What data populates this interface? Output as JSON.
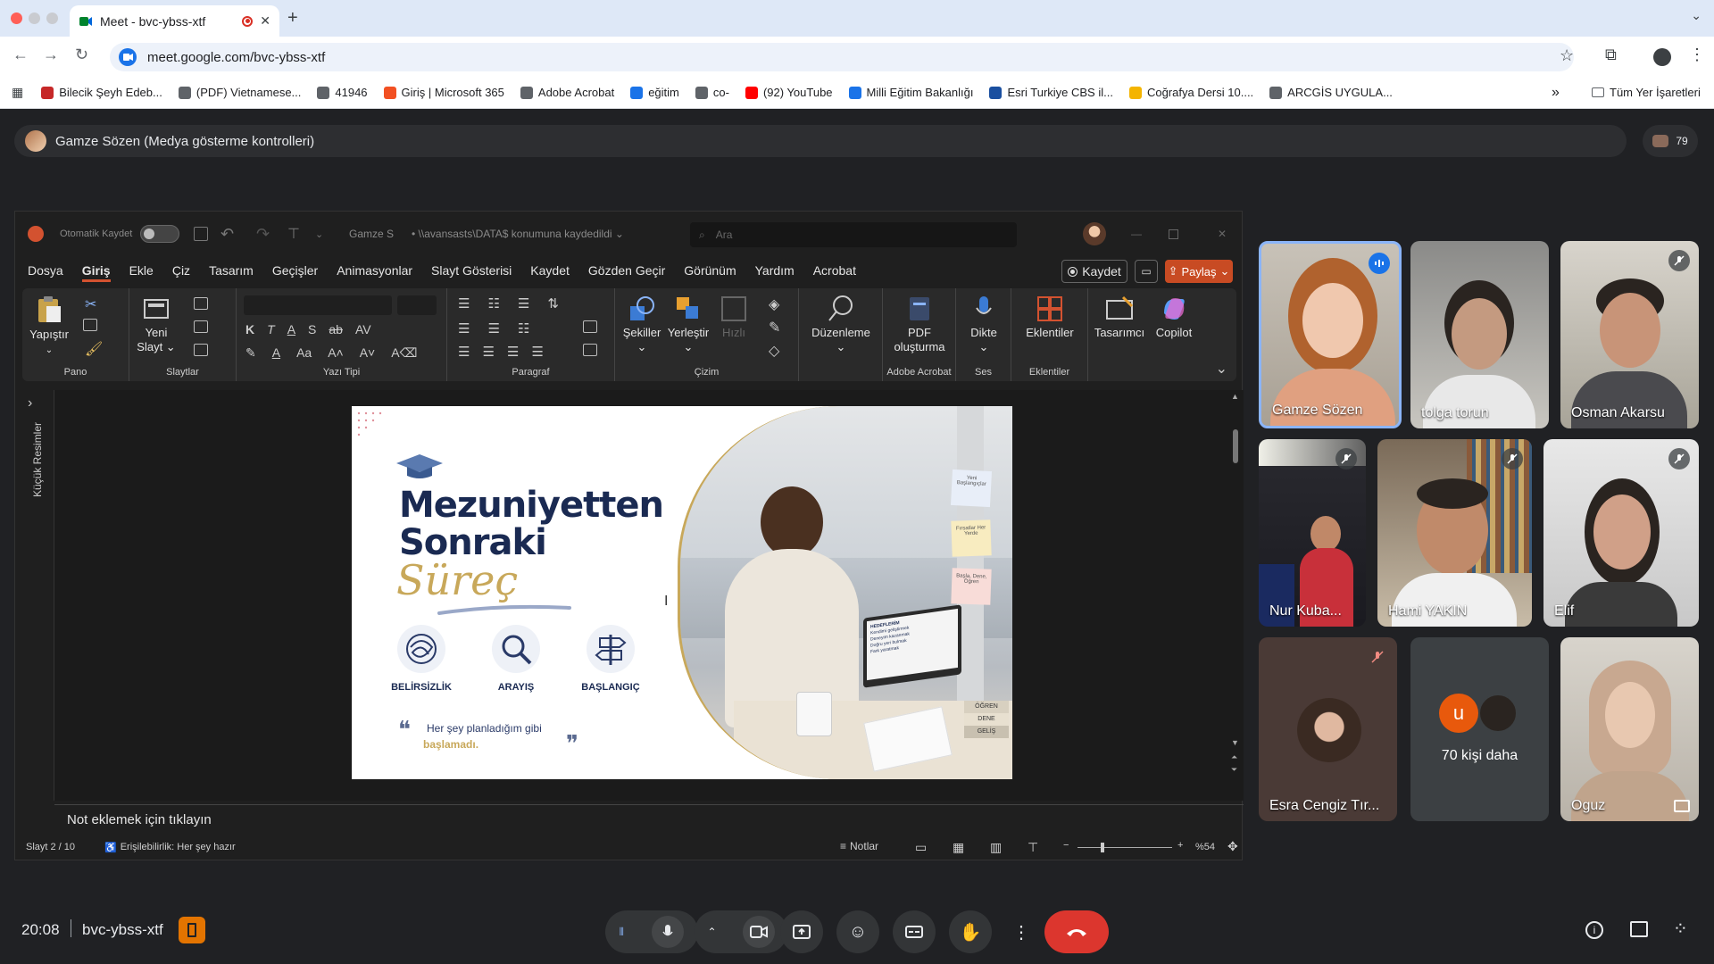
{
  "browser": {
    "tab_title": "Meet - bvc-ybss-xtf",
    "url": "meet.google.com/bvc-ybss-xtf",
    "bookmarks": [
      {
        "label": "Bilecik Şeyh Edeb...",
        "color": "#c62828"
      },
      {
        "label": "(PDF) Vietnamese...",
        "color": "#5f6368"
      },
      {
        "label": "41946",
        "color": "#5f6368"
      },
      {
        "label": "Giriş | Microsoft 365",
        "color": "#f25022"
      },
      {
        "label": "Adobe Acrobat",
        "color": "#5f6368"
      },
      {
        "label": "eğitim",
        "color": "#1a73e8"
      },
      {
        "label": "co-",
        "color": "#5f6368"
      },
      {
        "label": "(92) YouTube",
        "color": "#ff0000"
      },
      {
        "label": "Milli Eğitim Bakanlığı",
        "color": "#1a73e8"
      },
      {
        "label": "Esri Turkiye CBS il...",
        "color": "#1a4fa0"
      },
      {
        "label": "Coğrafya Dersi 10....",
        "color": "#f4b400"
      },
      {
        "label": "ARCGİS UYGULA...",
        "color": "#5f6368"
      }
    ],
    "bookmark_overflow": "»",
    "all_bookmarks": "Tüm Yer İşaretleri"
  },
  "meet": {
    "presenter_bar": "Gamze Sözen (Medya gösterme kontrolleri)",
    "participant_count": "79",
    "time": "20:08",
    "meeting_code": "bvc-ybss-xtf",
    "participants": [
      {
        "name": "Gamze Sözen",
        "speaking": true
      },
      {
        "name": "tolga torun"
      },
      {
        "name": "Osman Akarsu",
        "muted": true
      },
      {
        "name": "Nur Kuba...",
        "muted": true
      },
      {
        "name": "Hami YAKIN",
        "muted": true
      },
      {
        "name": "Elif",
        "muted": true
      },
      {
        "name": "Esra Cengiz Tır...",
        "muted": true
      },
      {
        "name": "70 kişi daha",
        "avatar_letter": "u"
      },
      {
        "name": "Oguz"
      }
    ]
  },
  "ppt": {
    "autosave": "Otomatik Kaydet",
    "doc_owner": "Gamze S",
    "save_location": "\\\\avansasts\\DATA$ konumuna kaydedildi",
    "search_placeholder": "Ara",
    "menu": [
      "Dosya",
      "Giriş",
      "Ekle",
      "Çiz",
      "Tasarım",
      "Geçişler",
      "Animasyonlar",
      "Slayt Gösterisi",
      "Kaydet",
      "Gözden Geçir",
      "Görünüm",
      "Yardım",
      "Acrobat"
    ],
    "record_btn": "Kaydet",
    "share_btn": "Paylaş",
    "ribbon": {
      "paste": "Yapıştır",
      "new_slide_1": "Yeni",
      "new_slide_2": "Slayt",
      "shapes": "Şekiller",
      "arrange": "Yerleştir",
      "quick": "Hızlı",
      "editing": "Düzenleme",
      "pdf_1": "PDF",
      "pdf_2": "oluşturma",
      "dictate": "Dikte",
      "addins": "Eklentiler",
      "designer": "Tasarımcı",
      "copilot": "Copilot",
      "groups": {
        "pano": "Pano",
        "slaytlar": "Slaytlar",
        "yazi": "Yazı Tipi",
        "paragraf": "Paragraf",
        "cizim": "Çizim",
        "acrobat": "Adobe Acrobat",
        "ses": "Ses",
        "eklentiler": "Eklentiler"
      }
    },
    "thumbs_label": "Küçük Resimler",
    "notes_placeholder": "Not eklemek için tıklayın",
    "status": {
      "slide": "Slayt 2 / 10",
      "accessibility": "Erişilebilirlik: Her şey hazır",
      "notes": "Notlar",
      "zoom": "%54"
    },
    "slide": {
      "title_1": "Mezuniyetten",
      "title_2": "Sonraki",
      "script": "Süreç",
      "icons": [
        "BELİRSİZLİK",
        "ARAYIŞ",
        "BAŞLANGIÇ"
      ],
      "quote_1": "Her şey planladığım gibi",
      "quote_2": "başlamadı.",
      "note_1": "Yeni Başlangıçlar",
      "note_2": "Fırsatlar Her Yerde",
      "note_3": "Başla, Dene, Öğren",
      "book_1": "ÖĞREN",
      "book_2": "DENE",
      "book_3": "GELİŞ",
      "laptop_head": "HEDEFLERİM",
      "laptop_items": [
        "Kendimi geliştirmek",
        "Deneyim kazanmak",
        "Doğru yeri bulmak",
        "Fark yaratmak"
      ]
    }
  }
}
